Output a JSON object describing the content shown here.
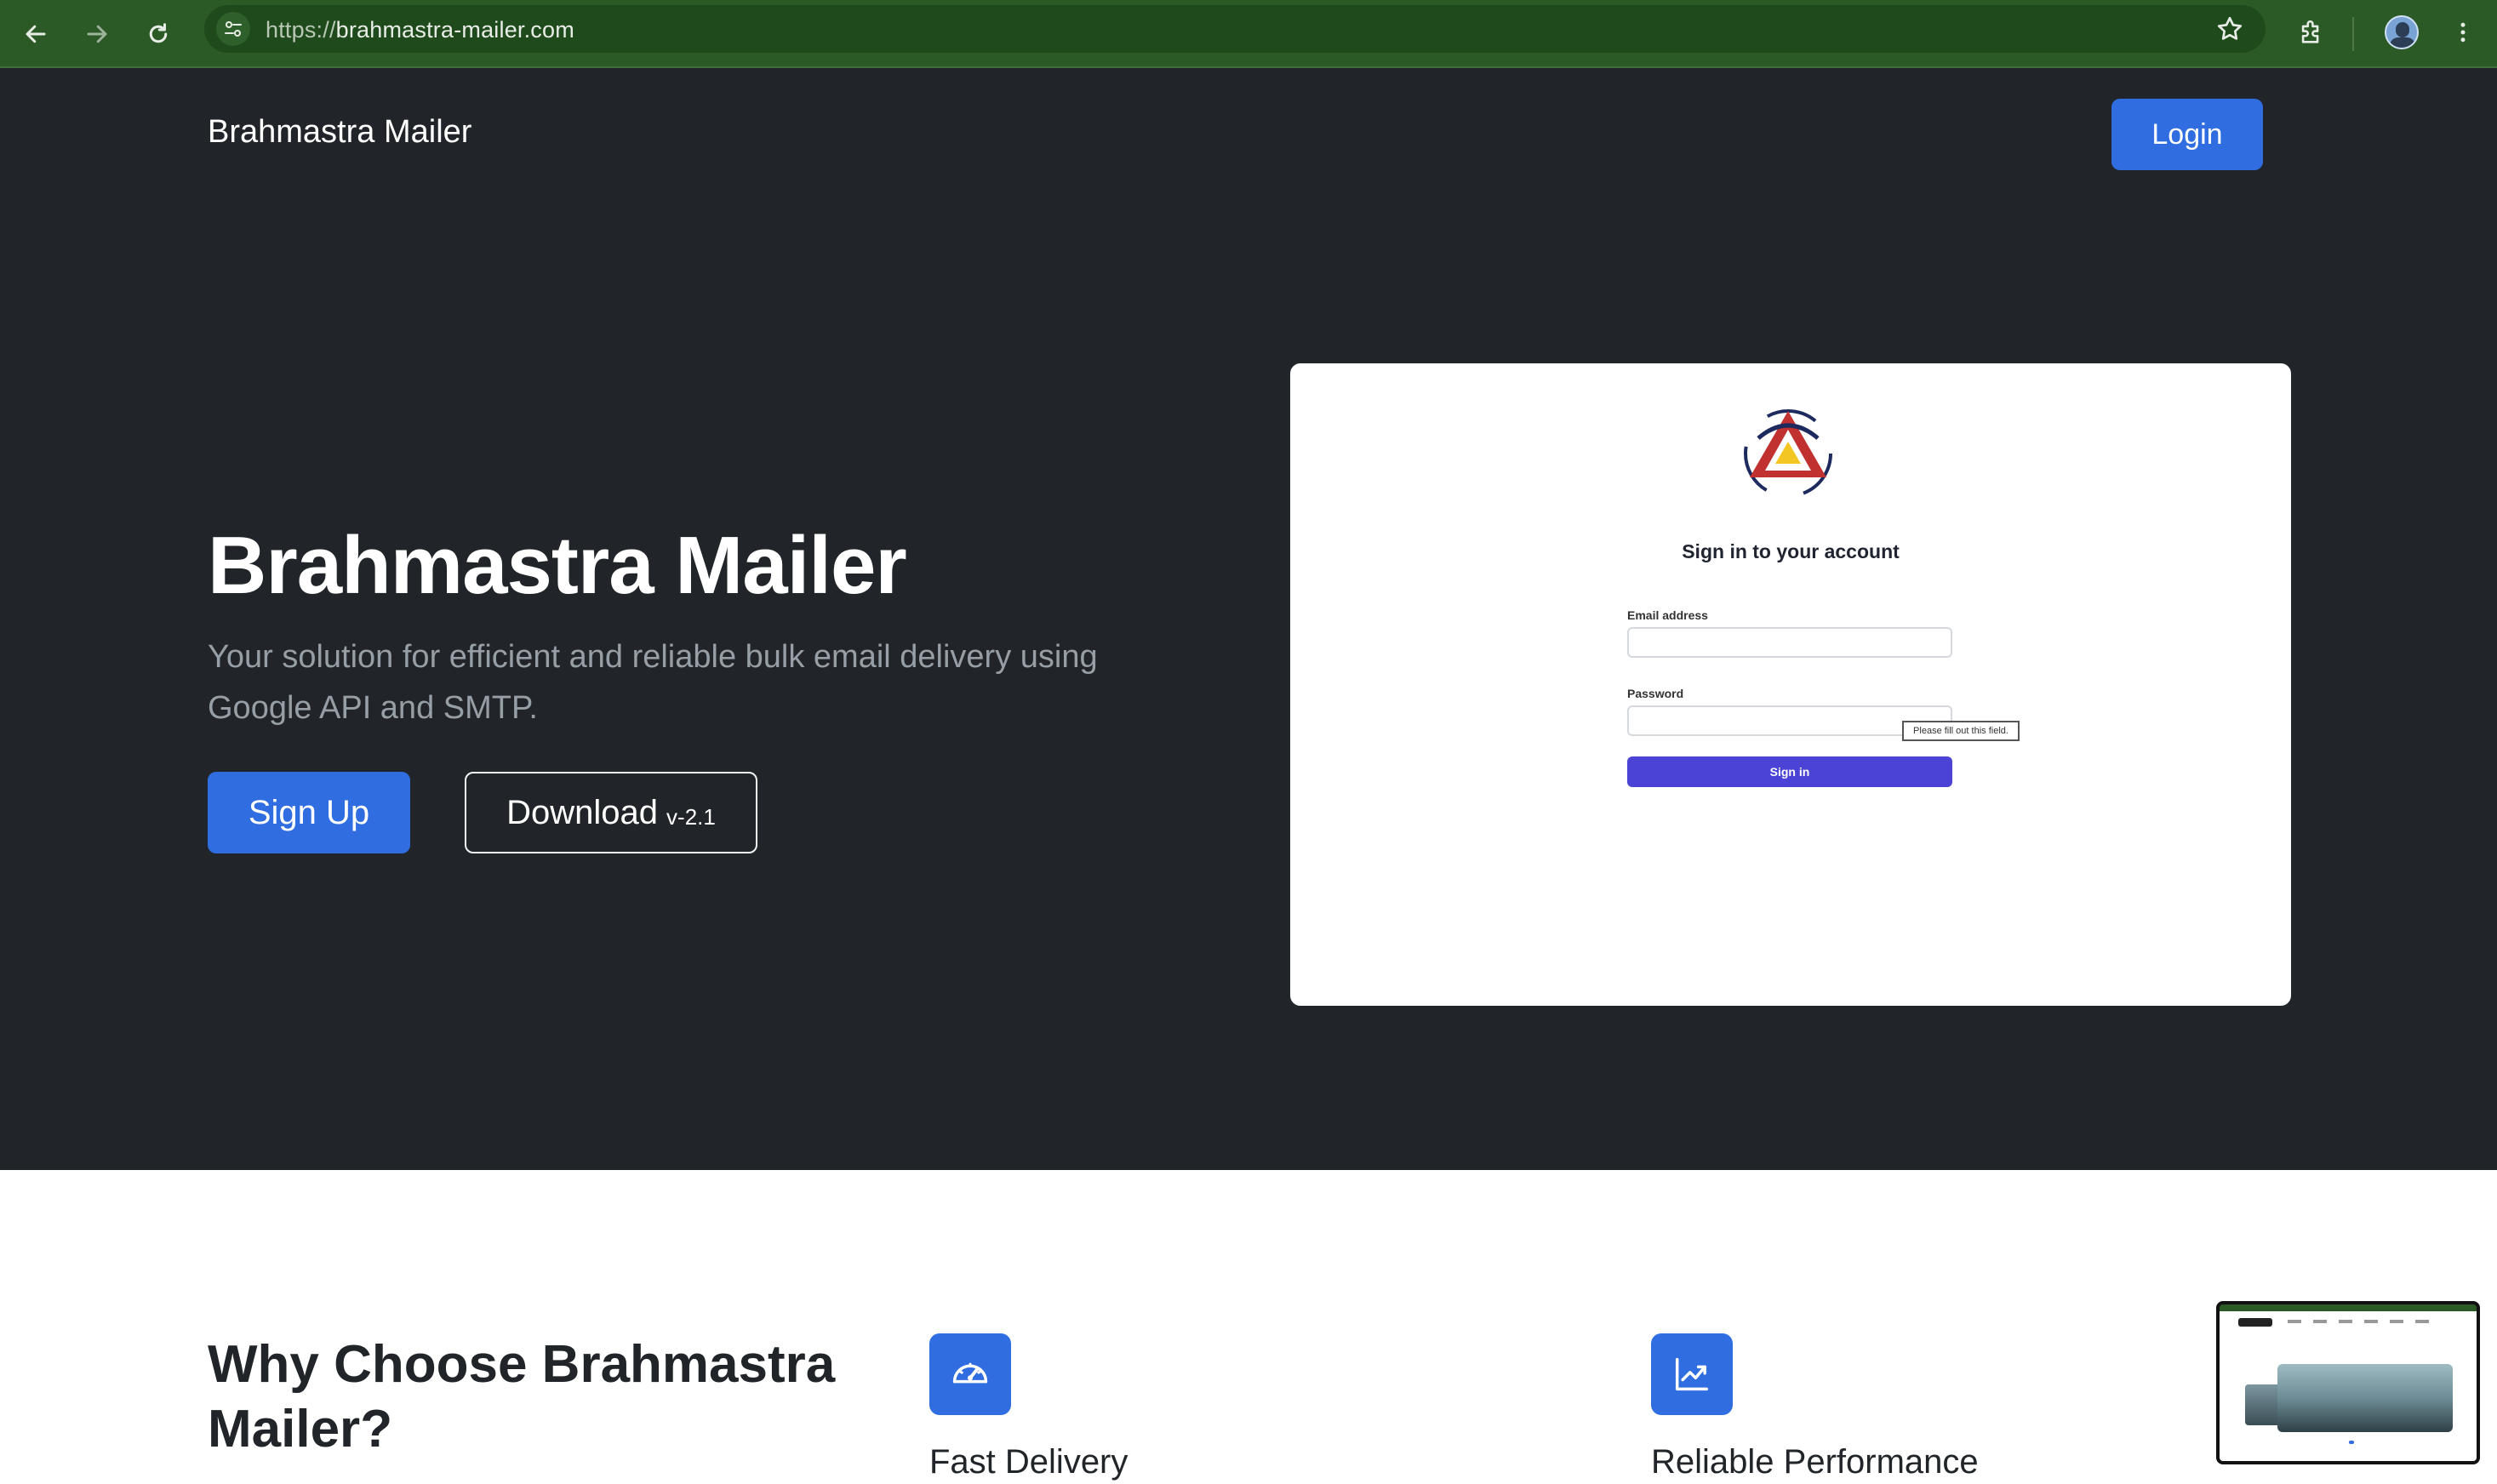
{
  "browser": {
    "url_protocol": "https://",
    "url_host": "brahmastra-mailer.com",
    "icons": [
      "back-arrow-icon",
      "forward-arrow-icon",
      "reload-icon",
      "site-settings-icon",
      "bookmark-star-icon",
      "extensions-icon",
      "profile-avatar",
      "kebab-menu-icon"
    ]
  },
  "navbar": {
    "brand": "Brahmastra Mailer",
    "login_label": "Login"
  },
  "hero": {
    "title": "Brahmastra Mailer",
    "subtitle": "Your solution for efficient and reliable bulk email delivery using Google API and SMTP.",
    "signup_label": "Sign Up",
    "download_label": "Download",
    "download_version": "v-2.1"
  },
  "preview": {
    "title": "Sign in to your account",
    "email_label": "Email address",
    "password_label": "Password",
    "tooltip": "Please fill out this field.",
    "signin_label": "Sign in"
  },
  "features": {
    "title": "Why Choose Brahmastra Mailer?",
    "items": [
      {
        "label": "Fast Delivery",
        "icon": "speedometer-icon"
      },
      {
        "label": "Reliable Performance",
        "icon": "trending-up-chart-icon"
      }
    ]
  },
  "colors": {
    "chrome": "#2b5a26",
    "hero_bg": "#212529",
    "primary": "#2f6de1",
    "preview_button": "#4b43d6"
  }
}
